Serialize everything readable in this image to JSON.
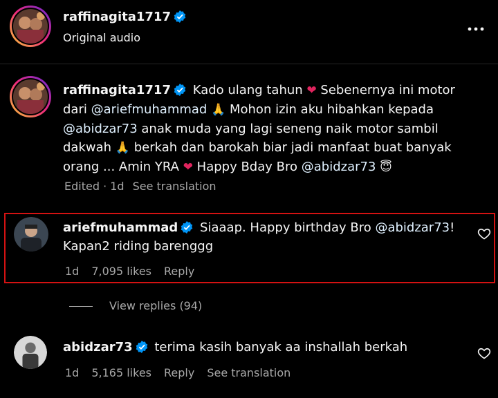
{
  "header": {
    "username": "raffinagita1717",
    "subtitle": "Original audio",
    "more_icon": "more-horizontal-icon"
  },
  "caption": {
    "username": "raffinagita1717",
    "line1_a": "Kado ulang tahun",
    "line1_b": "Sebenernya ini motor",
    "line2_a": "dari ",
    "line2_mention": "@ariefmuhammad",
    "line2_b": "Mohon izin aku hibahkan kepada",
    "line3_mention": "@abidzar73",
    "line3_b": " anak muda yang lagi seneng naik motor sambil",
    "line4_a": "dakwah",
    "line4_b": "berkah dan barokah biar jadi manfaat buat banyak",
    "line5_a": "orang ... Amin YRA",
    "line5_b": "Happy Bday Bro ",
    "line5_mention": "@abidzar73",
    "meta_edited": "Edited · 1d",
    "meta_translate": "See translation",
    "emojis": [
      "❤",
      "🙏",
      "🙏",
      "❤",
      "😇"
    ]
  },
  "comments": [
    {
      "username": "ariefmuhammad",
      "text_a": "Siaaap. Happy birthday Bro ",
      "mention": "@abidzar73",
      "text_b": "!",
      "text_line2": "Kapan2 riding barenggg",
      "time": "1d",
      "likes": "7,095 likes",
      "reply": "Reply",
      "view_replies": "View replies (94)"
    },
    {
      "username": "abidzar73",
      "text": "terima kasih banyak aa inshallah berkah",
      "time": "1d",
      "likes": "5,165 likes",
      "reply": "Reply",
      "translate": "See translation"
    }
  ],
  "colors": {
    "highlight": "#d41212",
    "verified": "#0095f6",
    "heart": "#ff3040",
    "muted": "#a8a8a8"
  }
}
